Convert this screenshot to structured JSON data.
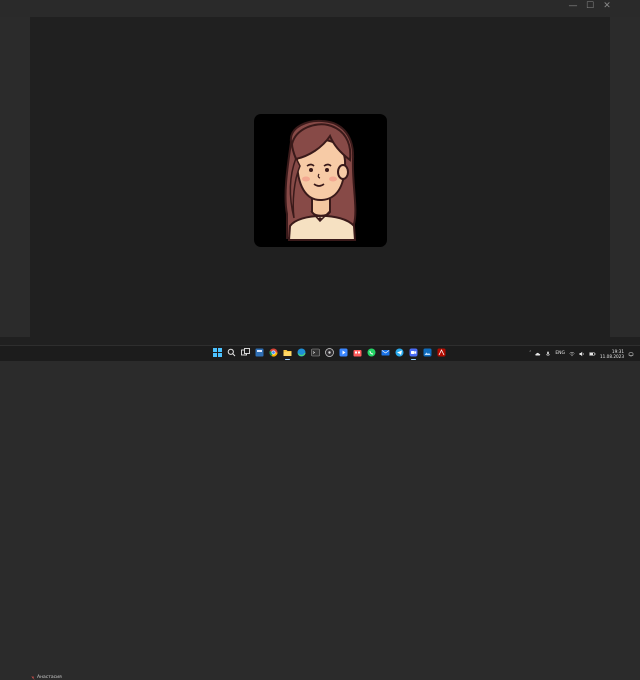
{
  "window": {
    "controls": [
      "—",
      "☐",
      "✕"
    ]
  },
  "participant": {
    "name": "Анастасия",
    "mic": "muted"
  },
  "taskbar": {
    "icons": [
      "windows-start-icon",
      "search-icon",
      "task-view-icon",
      "widgets-icon",
      "chrome-icon",
      "file-explorer-icon",
      "edge-icon",
      "terminal-icon",
      "obs-icon",
      "media-app-icon",
      "store-icon",
      "whatsapp-icon",
      "mail-icon",
      "telegram-icon",
      "zoom-icon",
      "photos-icon",
      "acrobat-icon"
    ],
    "tray": {
      "language": "ENG",
      "time": "19:31",
      "date": "11.08.2023"
    }
  },
  "colors": {
    "background": "#202020",
    "accent": "#9ad0ff"
  }
}
